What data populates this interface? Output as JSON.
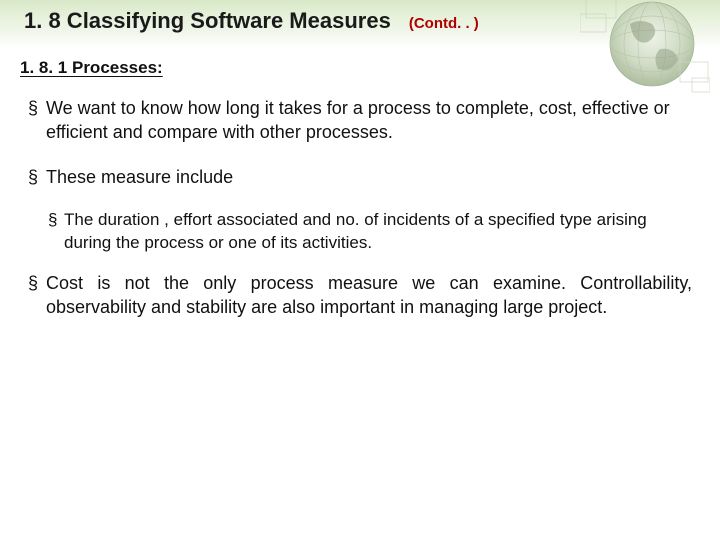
{
  "header": {
    "title": "1. 8 Classifying Software Measures",
    "contd": "(Contd. . )"
  },
  "subtitle": "1. 8. 1 Processes:",
  "bullets": [
    "We want to know how long it takes for a process to complete, cost, effective or efficient and compare with other processes.",
    "These measure include",
    "Cost is not the only process measure we can examine. Controllability, observability and stability are also important in managing large project."
  ],
  "sub_bullets": [
    "The duration , effort associated and no. of incidents of a specified type arising during the process or one of its activities."
  ]
}
